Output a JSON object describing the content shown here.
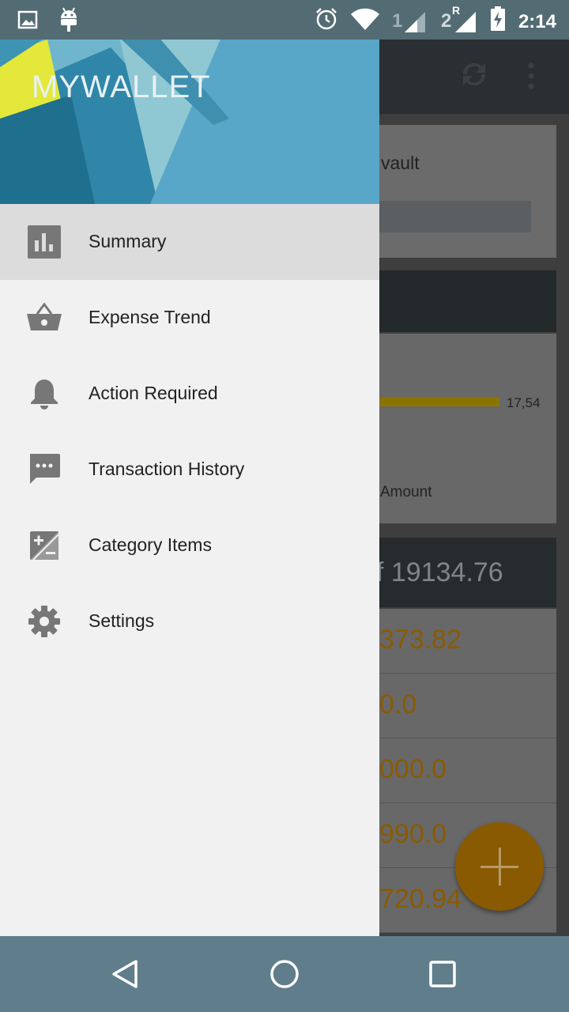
{
  "status_bar": {
    "time": "2:14",
    "signal1_label": "1",
    "signal2_label": "2",
    "signal2_roaming": "R",
    "icons": [
      "image-icon",
      "android-icon",
      "alarm-icon",
      "wifi-icon",
      "signal-icon",
      "battery-charging-icon"
    ]
  },
  "drawer": {
    "app_title": "MYWALLET",
    "items": [
      {
        "label": "Summary",
        "icon": "bar-chart-icon",
        "active": true
      },
      {
        "label": "Expense Trend",
        "icon": "basket-icon"
      },
      {
        "label": "Action Required",
        "icon": "bell-icon"
      },
      {
        "label": "Transaction History",
        "icon": "message-icon"
      },
      {
        "label": "Category Items",
        "icon": "plus-minus-icon"
      },
      {
        "label": "Settings",
        "icon": "gear-icon"
      }
    ]
  },
  "background_app": {
    "vault_label": "vault",
    "bar_value": "17,54",
    "amount_label": "Amount",
    "total_value": "f 19134.76",
    "row_values": [
      "373.82",
      "0.0",
      "000.0",
      "990.0",
      "720.94"
    ],
    "toolbar_icons": [
      "sync-icon",
      "more-vert-icon"
    ]
  },
  "colors": {
    "accent": "#ff9800",
    "drawer_bg": "#f1f1f1",
    "status_bar": "#536b73",
    "nav_bar": "#607d8b"
  },
  "nav_bar": {
    "icons": [
      "back-icon",
      "home-icon",
      "recents-icon"
    ]
  }
}
